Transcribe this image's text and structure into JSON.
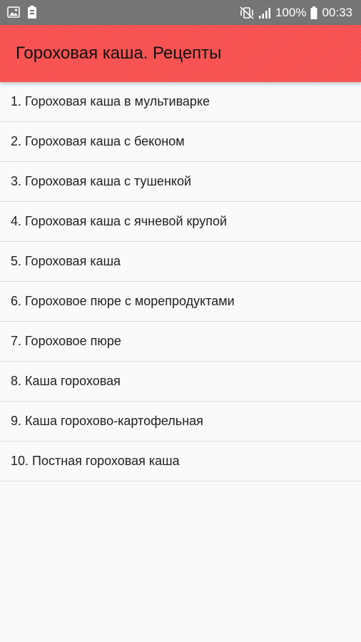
{
  "status_bar": {
    "icons_left": [
      "image-icon",
      "battery-saver-icon"
    ],
    "icons_right": [
      "vibrate-icon",
      "signal-icon",
      "battery-icon"
    ],
    "battery": "100%",
    "time": "00:33"
  },
  "app_bar": {
    "title": "Гороховая каша. Рецепты",
    "color": "#f75050"
  },
  "recipes": [
    "1. Гороховая каша в мультиварке",
    "2. Гороховая каша с беконом",
    "3. Гороховая каша с тушенкой",
    "4. Гороховая каша с ячневой крупой",
    "5. Гороховая каша",
    "6. Гороховое пюре с морепродуктами",
    "7. Гороховое пюре",
    "8. Каша гороховая",
    "9. Каша горохово-картофельная",
    "10. Постная гороховая каша"
  ]
}
